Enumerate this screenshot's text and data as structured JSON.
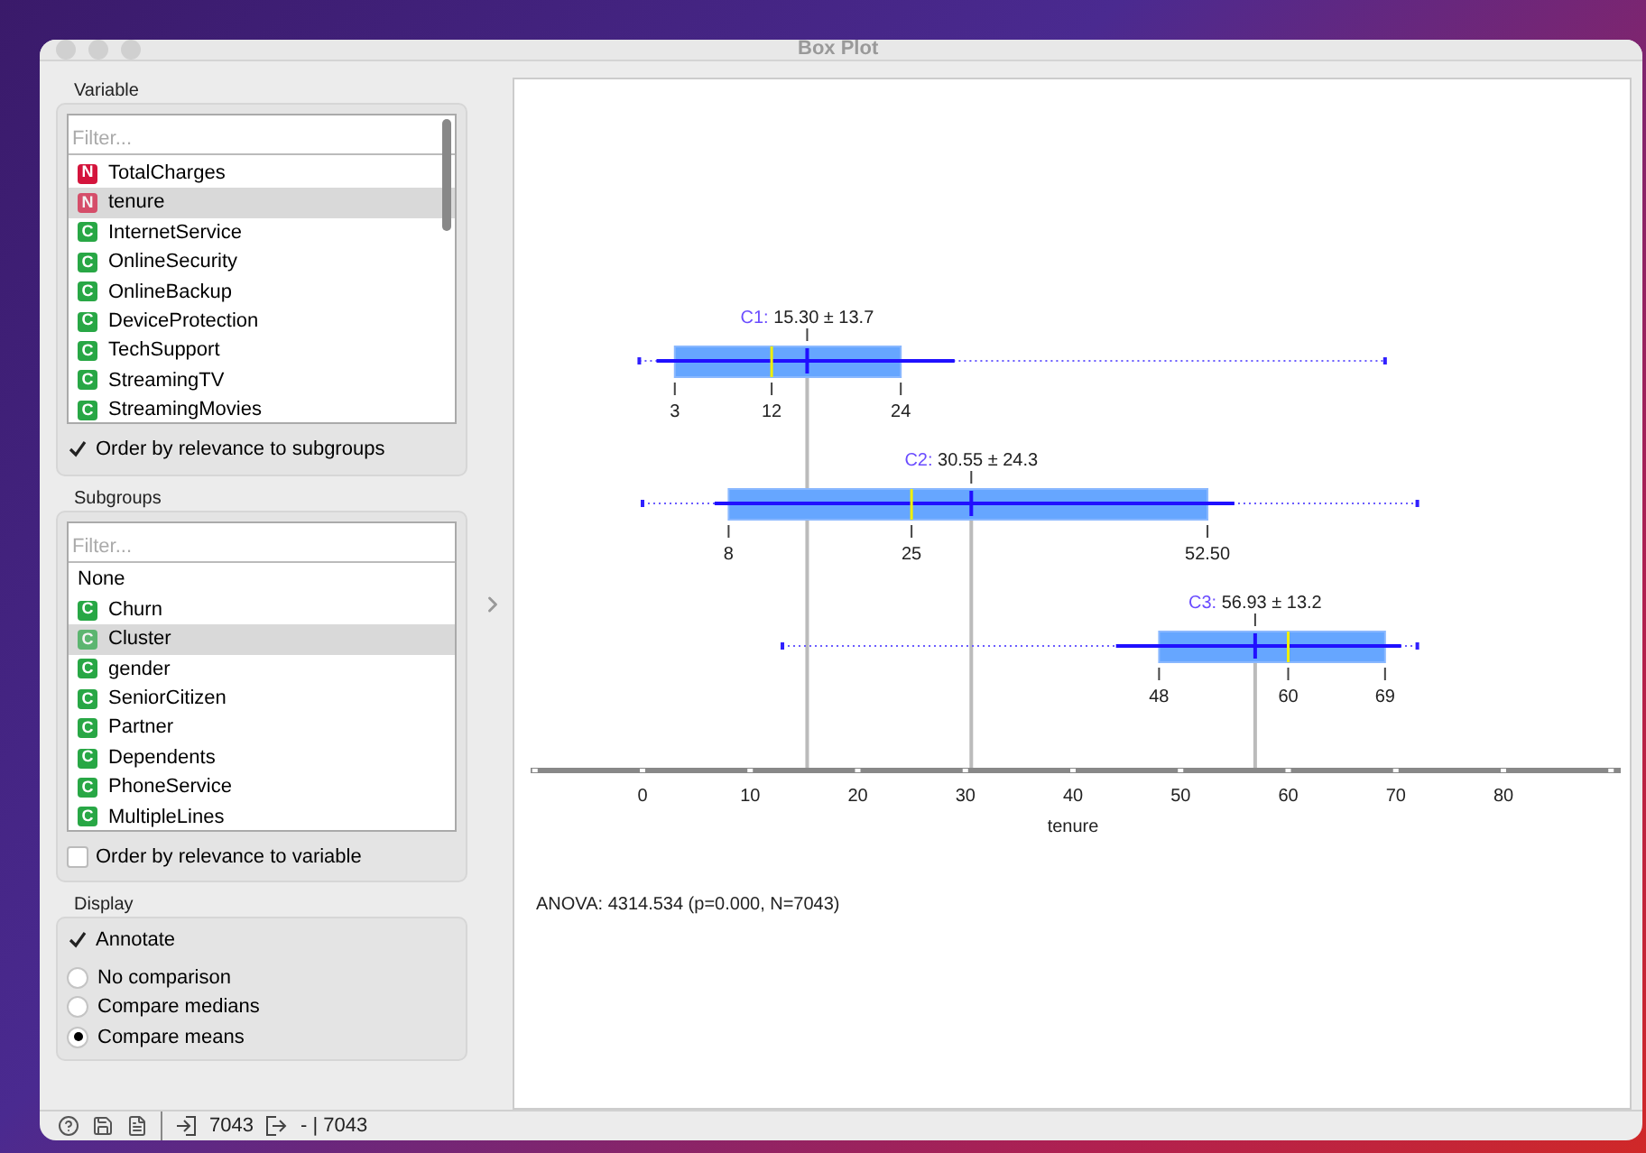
{
  "window": {
    "title": "Box Plot"
  },
  "variable": {
    "heading": "Variable",
    "filter": {
      "placeholder": "Filter..."
    },
    "items": [
      {
        "badge": "N",
        "kind": "numeric",
        "name": "TotalCharges",
        "selected": false
      },
      {
        "badge": "N",
        "kind": "numeric",
        "name": "tenure",
        "selected": true
      },
      {
        "badge": "C",
        "kind": "categorical",
        "name": "InternetService",
        "selected": false
      },
      {
        "badge": "C",
        "kind": "categorical",
        "name": "OnlineSecurity",
        "selected": false
      },
      {
        "badge": "C",
        "kind": "categorical",
        "name": "OnlineBackup",
        "selected": false
      },
      {
        "badge": "C",
        "kind": "categorical",
        "name": "DeviceProtection",
        "selected": false
      },
      {
        "badge": "C",
        "kind": "categorical",
        "name": "TechSupport",
        "selected": false
      },
      {
        "badge": "C",
        "kind": "categorical",
        "name": "StreamingTV",
        "selected": false
      },
      {
        "badge": "C",
        "kind": "categorical",
        "name": "StreamingMovies",
        "selected": false
      }
    ],
    "order": {
      "label": "Order by relevance to subgroups",
      "checked": true
    }
  },
  "subgroups": {
    "heading": "Subgroups",
    "filter": {
      "placeholder": "Filter..."
    },
    "items": [
      {
        "kind": "none",
        "name": "None",
        "selected": false
      },
      {
        "badge": "C",
        "kind": "categorical",
        "name": "Churn",
        "selected": false
      },
      {
        "badge": "C",
        "kind": "categorical",
        "name": "Cluster",
        "selected": true
      },
      {
        "badge": "C",
        "kind": "categorical",
        "name": "gender",
        "selected": false
      },
      {
        "badge": "C",
        "kind": "categorical",
        "name": "SeniorCitizen",
        "selected": false
      },
      {
        "badge": "C",
        "kind": "categorical",
        "name": "Partner",
        "selected": false
      },
      {
        "badge": "C",
        "kind": "categorical",
        "name": "Dependents",
        "selected": false
      },
      {
        "badge": "C",
        "kind": "categorical",
        "name": "PhoneService",
        "selected": false
      },
      {
        "badge": "C",
        "kind": "categorical",
        "name": "MultipleLines",
        "selected": false
      }
    ],
    "order": {
      "label": "Order by relevance to variable",
      "checked": false
    }
  },
  "display": {
    "heading": "Display",
    "annotate": {
      "label": "Annotate",
      "checked": true
    },
    "options": [
      {
        "label": "No comparison",
        "selected": false
      },
      {
        "label": "Compare medians",
        "selected": false
      },
      {
        "label": "Compare means",
        "selected": true
      }
    ]
  },
  "plot": {
    "groups": [
      {
        "name": "C1:",
        "stat": "15.30 ± 13.7",
        "q1": "3",
        "median": "12",
        "q3": "24"
      },
      {
        "name": "C2:",
        "stat": "30.55 ± 24.3",
        "q1": "8",
        "median": "25",
        "q3": "52.50"
      },
      {
        "name": "C3:",
        "stat": "56.93 ± 13.2",
        "q1": "48",
        "median": "60",
        "q3": "69"
      }
    ],
    "axis_ticks": [
      "0",
      "10",
      "20",
      "30",
      "40",
      "50",
      "60",
      "70",
      "80"
    ],
    "axis_label": "tenure",
    "anova": "ANOVA: 4314.534 (p=0.000, N=7043)"
  },
  "status_bar": {
    "input_count": "7043",
    "output_count": "- | 7043"
  }
}
